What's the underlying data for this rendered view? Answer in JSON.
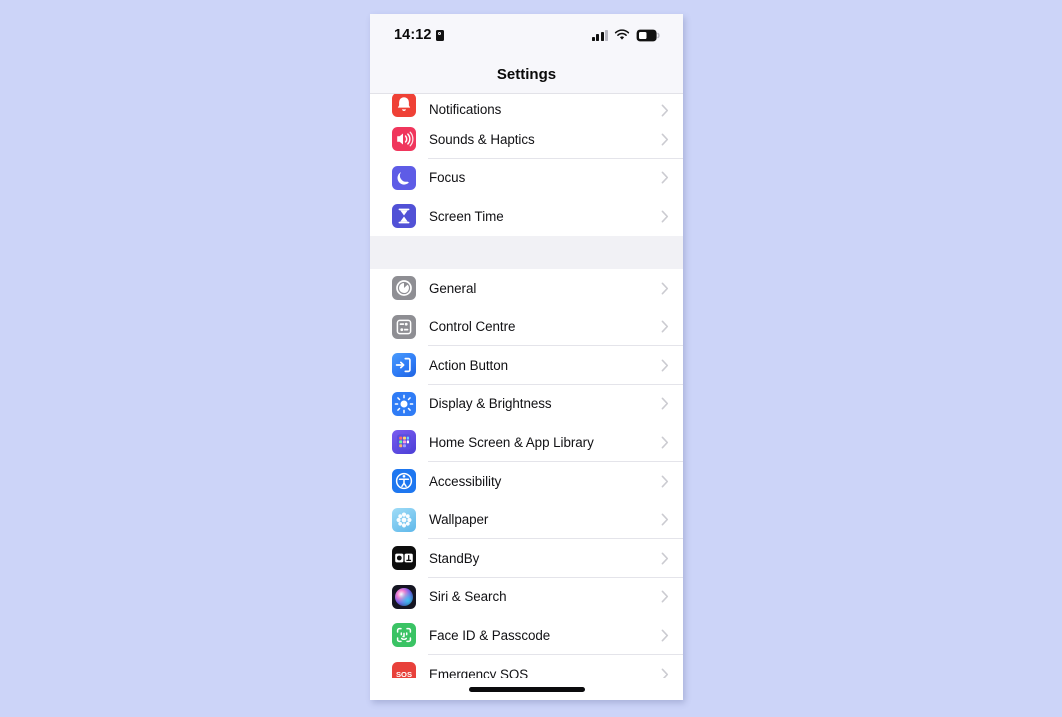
{
  "background_color": "#ccd4f8",
  "highlight_color": "#22e22a",
  "phone": {
    "status_bar": {
      "time": "14:12",
      "lock_icon": "lock-icon",
      "cellular_icon": "cellular-signal-icon",
      "wifi_icon": "wifi-icon",
      "battery_icon": "battery-icon"
    },
    "nav": {
      "title": "Settings"
    },
    "home_indicator": "home-indicator"
  },
  "groups": [
    {
      "id": "group-notifications",
      "partial": true,
      "rows": [
        {
          "label": "Notifications",
          "icon": "notifications-icon",
          "icon_color": "#ef4136",
          "clipped": true
        },
        {
          "label": "Sounds & Haptics",
          "icon": "sounds-haptics-icon",
          "icon_color": "#f0365c",
          "clipped": false
        },
        {
          "label": "Focus",
          "icon": "focus-icon",
          "icon_color": "#5e5ce6",
          "clipped": false
        },
        {
          "label": "Screen Time",
          "icon": "screen-time-icon",
          "icon_color": "#5151d6",
          "clipped": false
        }
      ]
    },
    {
      "id": "group-system",
      "partial": false,
      "rows": [
        {
          "label": "General",
          "icon": "general-icon",
          "icon_color": "#8e8e93",
          "clipped": false
        },
        {
          "label": "Control Centre",
          "icon": "control-centre-icon",
          "icon_color": "#8e8e93",
          "clipped": false
        },
        {
          "label": "Action Button",
          "icon": "action-button-icon",
          "icon_color": "#2f7cf6",
          "clipped": false,
          "highlighted": true
        },
        {
          "label": "Display & Brightness",
          "icon": "display-brightness-icon",
          "icon_color": "#2f7cf6",
          "clipped": false
        },
        {
          "label": "Home Screen & App Library",
          "icon": "home-screen-icon",
          "icon_color": "#5b5be0",
          "clipped": false
        },
        {
          "label": "Accessibility",
          "icon": "accessibility-icon",
          "icon_color": "#1e77f0",
          "clipped": false
        },
        {
          "label": "Wallpaper",
          "icon": "wallpaper-icon",
          "icon_color": "#63c7f0",
          "clipped": false
        },
        {
          "label": "StandBy",
          "icon": "standby-icon",
          "icon_color": "#0d0d0d",
          "clipped": false
        },
        {
          "label": "Siri & Search",
          "icon": "siri-search-icon",
          "icon_color": "#1b1b2a",
          "clipped": false
        },
        {
          "label": "Face ID & Passcode",
          "icon": "face-id-icon",
          "icon_color": "#3ac364",
          "clipped": false
        },
        {
          "label": "Emergency SOS",
          "icon": "emergency-sos-icon",
          "icon_color": "#e8413b",
          "clipped": false
        }
      ]
    }
  ]
}
